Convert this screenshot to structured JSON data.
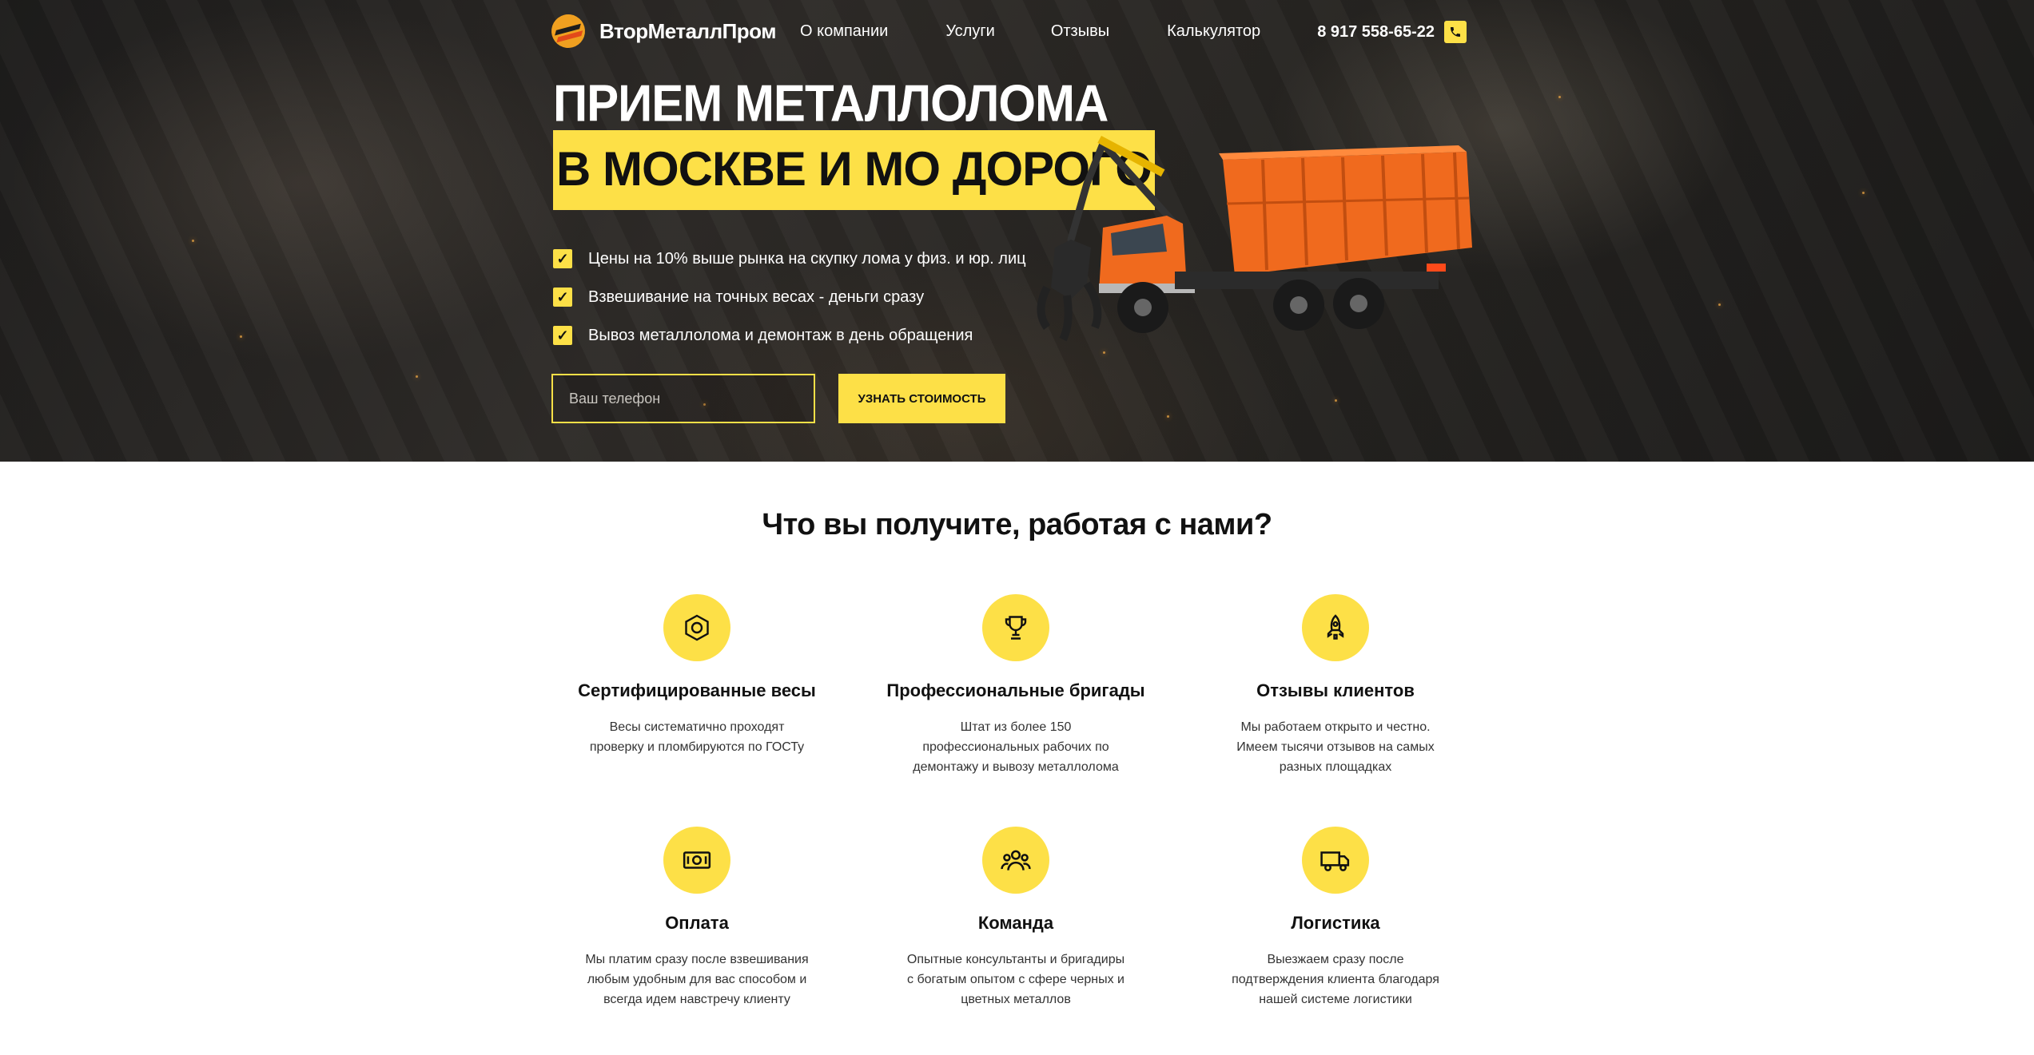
{
  "nav": {
    "logo_text": "ВторМеталлПром",
    "links": [
      "О компании",
      "Услуги",
      "Отзывы",
      "Калькулятор"
    ],
    "phone": "8 917 558-65-22"
  },
  "hero": {
    "title_line1": "ПРИЕМ МЕТАЛЛОЛОМА",
    "title_line2": "В МОСКВЕ И МО ДОРОГО",
    "features": [
      "Цены на 10% выше рынка на скупку лома у физ. и юр. лиц",
      "Взвешивание на точных весах - деньги сразу",
      "Вывоз металлолома и демонтаж в день обращения"
    ],
    "phone_placeholder": "Ваш телефон",
    "cta_label": "УЗНАТЬ СТОИМОСТЬ"
  },
  "benefits": {
    "title": "Что вы получите, работая с нами?",
    "items": [
      {
        "icon": "certified-scales-icon",
        "title": "Сертифицированные весы",
        "text": "Весы систематично проходят проверку и пломбируются по ГОСТу"
      },
      {
        "icon": "trophy-icon",
        "title": "Профессиональные бригады",
        "text": "Штат из более 150 профессиональных рабочих по демонтажу и вывозу металлолома"
      },
      {
        "icon": "rocket-icon",
        "title": "Отзывы клиентов",
        "text": "Мы работаем открыто и честно. Имеем тысячи отзывов на самых разных площадках"
      },
      {
        "icon": "money-icon",
        "title": "Оплата",
        "text": "Мы платим сразу после взвешивания любым удобным для вас способом и всегда идем навстречу клиенту"
      },
      {
        "icon": "team-icon",
        "title": "Команда",
        "text": "Опытные консультанты и бригадиры с богатым опытом с сфере черных и цветных металлов"
      },
      {
        "icon": "truck-icon",
        "title": "Логистика",
        "text": "Выезжаем сразу после подтверждения клиента благодаря нашей системе логистики"
      }
    ]
  },
  "colors": {
    "accent": "#fde047",
    "dark": "#1d1c1b",
    "truck_orange": "#f06a1e"
  }
}
